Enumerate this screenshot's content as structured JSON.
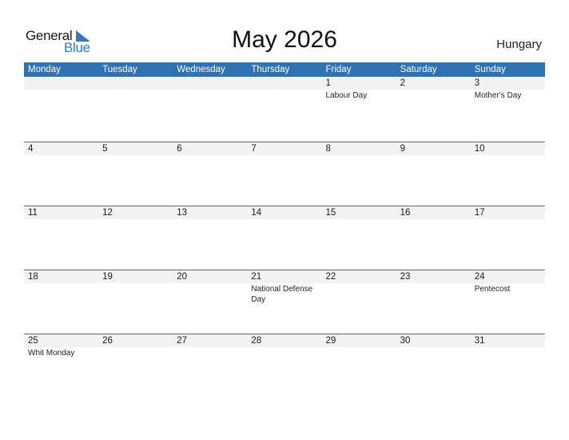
{
  "logo": {
    "general": "General",
    "blue": "Blue",
    "accent_color": "#2e7bc4"
  },
  "title": "May 2026",
  "country": "Hungary",
  "header_color": "#2e72b2",
  "weekdays": [
    "Monday",
    "Tuesday",
    "Wednesday",
    "Thursday",
    "Friday",
    "Saturday",
    "Sunday"
  ],
  "weeks": [
    {
      "days": [
        "",
        "",
        "",
        "",
        "1",
        "2",
        "3"
      ],
      "events": [
        "",
        "",
        "",
        "",
        "Labour Day",
        "",
        "Mother's Day"
      ]
    },
    {
      "days": [
        "4",
        "5",
        "6",
        "7",
        "8",
        "9",
        "10"
      ],
      "events": [
        "",
        "",
        "",
        "",
        "",
        "",
        ""
      ]
    },
    {
      "days": [
        "11",
        "12",
        "13",
        "14",
        "15",
        "16",
        "17"
      ],
      "events": [
        "",
        "",
        "",
        "",
        "",
        "",
        ""
      ]
    },
    {
      "days": [
        "18",
        "19",
        "20",
        "21",
        "22",
        "23",
        "24"
      ],
      "events": [
        "",
        "",
        "",
        "National Defense Day",
        "",
        "",
        "Pentecost"
      ]
    },
    {
      "days": [
        "25",
        "26",
        "27",
        "28",
        "29",
        "30",
        "31"
      ],
      "events": [
        "Whit Monday",
        "",
        "",
        "",
        "",
        "",
        ""
      ]
    }
  ]
}
